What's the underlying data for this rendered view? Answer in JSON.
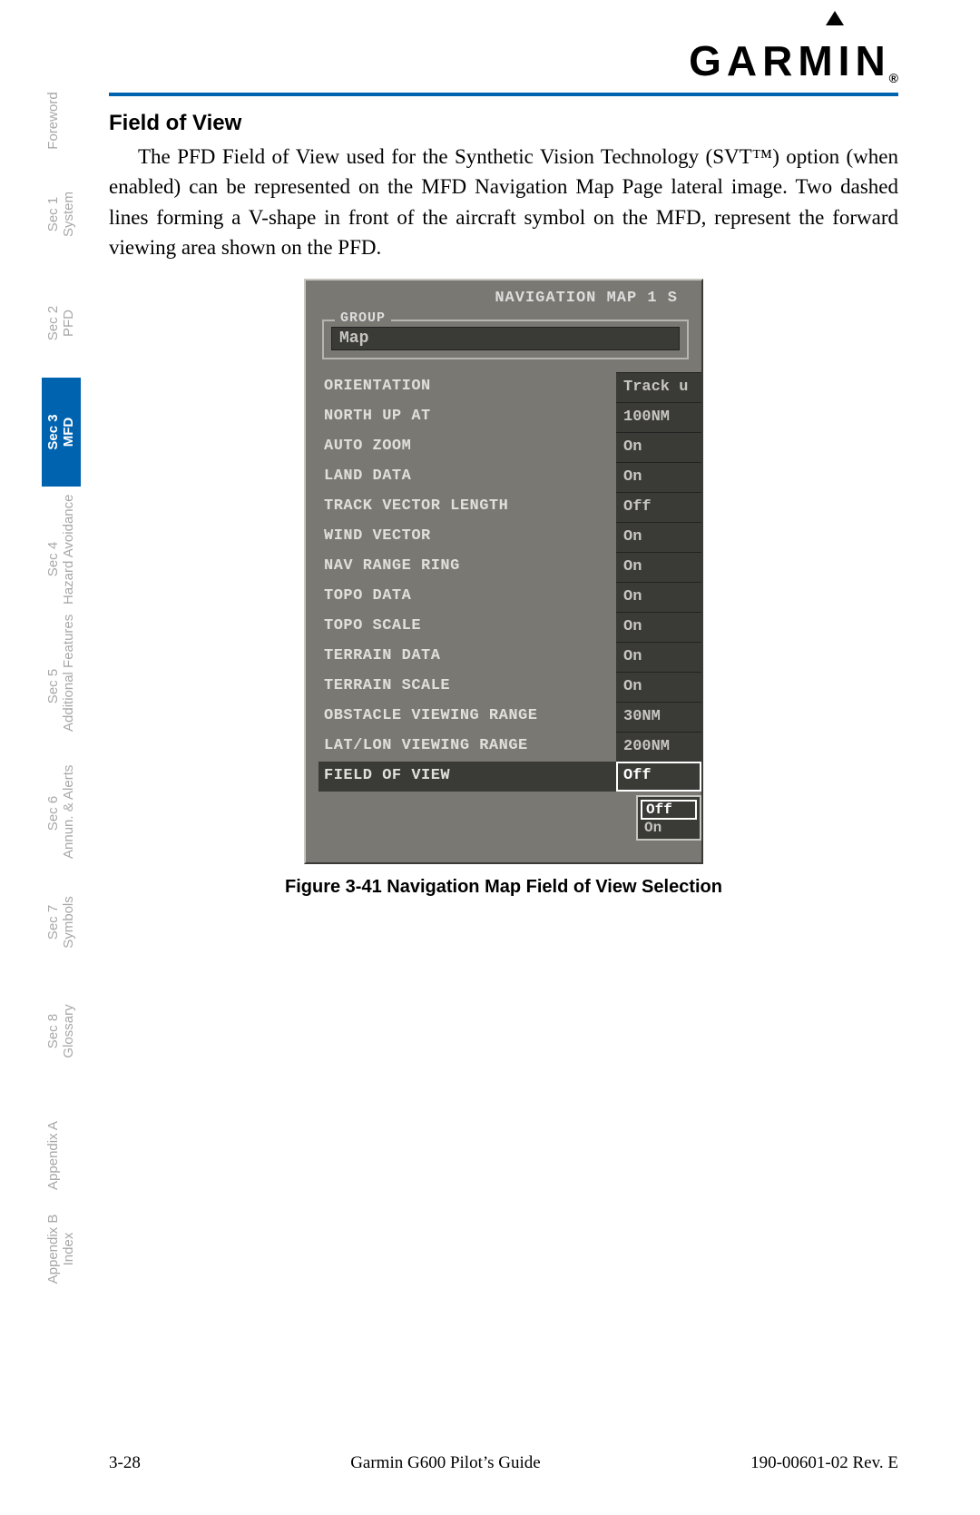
{
  "logo_text": "GARMIN",
  "logo_reg": "®",
  "heading": "Field of View",
  "paragraph": "The PFD Field of View used for the Synthetic Vision Technology (SVT™) option (when enabled) can be represented on the MFD Navigation Map Page lateral image. Two dashed lines forming a V-shape in front of the aircraft symbol on the MFD, represent the forward viewing area shown on the PFD.",
  "device": {
    "title": "NAVIGATION MAP 1 S",
    "group_label": "GROUP",
    "group_value": "Map",
    "rows": [
      {
        "label": "ORIENTATION",
        "value": "Track u"
      },
      {
        "label": "NORTH UP AT",
        "value": "100NM"
      },
      {
        "label": "AUTO ZOOM",
        "value": "On"
      },
      {
        "label": "LAND DATA",
        "value": "On"
      },
      {
        "label": "TRACK VECTOR LENGTH",
        "value": "Off"
      },
      {
        "label": "WIND VECTOR",
        "value": "On"
      },
      {
        "label": "NAV RANGE RING",
        "value": "On"
      },
      {
        "label": "TOPO DATA",
        "value": "On"
      },
      {
        "label": "TOPO SCALE",
        "value": "On"
      },
      {
        "label": "TERRAIN DATA",
        "value": "On"
      },
      {
        "label": "TERRAIN SCALE",
        "value": "On"
      },
      {
        "label": "OBSTACLE VIEWING RANGE",
        "value": "30NM"
      },
      {
        "label": "LAT/LON VIEWING RANGE",
        "value": "200NM"
      },
      {
        "label": "FIELD OF VIEW",
        "value": "Off"
      }
    ],
    "dropdown": [
      "Off",
      "On"
    ]
  },
  "caption": "Figure 3-41  Navigation Map Field of View Selection",
  "tabs": [
    {
      "l1": "",
      "l2": "Foreword"
    },
    {
      "l1": "Sec 1",
      "l2": "System"
    },
    {
      "l1": "Sec 2",
      "l2": "PFD"
    },
    {
      "l1": "Sec 3",
      "l2": "MFD"
    },
    {
      "l1": "Sec 4",
      "l2": "Hazard Avoidance"
    },
    {
      "l1": "Sec 5",
      "l2": "Additional Features"
    },
    {
      "l1": "Sec 6",
      "l2": "Annun. & Alerts"
    },
    {
      "l1": "Sec 7",
      "l2": "Symbols"
    },
    {
      "l1": "Sec 8",
      "l2": "Glossary"
    },
    {
      "l1": "",
      "l2": "Appendix A"
    },
    {
      "l1": "Appendix B",
      "l2": "Index"
    }
  ],
  "active_tab_index": 3,
  "footer": {
    "page": "3-28",
    "title": "Garmin G600 Pilot’s Guide",
    "doc": "190-00601-02  Rev. E"
  }
}
